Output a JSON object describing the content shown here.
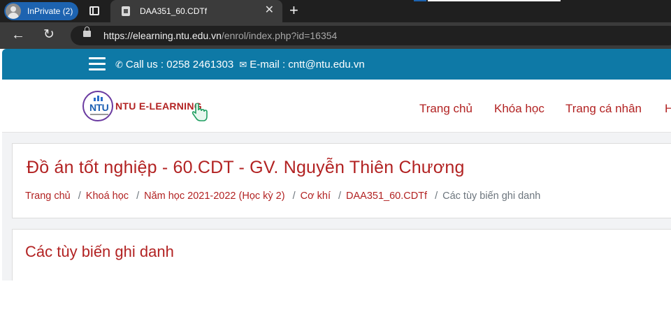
{
  "browser": {
    "profile_label": "InPrivate (2)",
    "tab_title": "DAA351_60.CDTf",
    "tab_close": "✕",
    "new_tab": "+",
    "url_host": "https://elearning.ntu.edu.vn",
    "url_path": "/enrol/index.php?id=16354"
  },
  "topbar": {
    "phone_label": "Call us : 0258 2461303",
    "email_label": "E-mail : cntt@ntu.edu.vn"
  },
  "header": {
    "logo_circle_text": "NTU",
    "logo_text": "NTU E-LEARNING",
    "nav": [
      "Trang chủ",
      "Khóa học",
      "Trang cá nhân",
      "H"
    ]
  },
  "course": {
    "title": "Đồ án tốt nghiệp - 60.CDT - GV. Nguyễn Thiên Chương",
    "breadcrumb": [
      "Trang chủ",
      "Khoá học",
      "Năm học 2021-2022 (Học kỳ 2)",
      "Cơ khí",
      "DAA351_60.CDTf"
    ],
    "breadcrumb_current": "Các tùy biến ghi danh",
    "separator": "/"
  },
  "section": {
    "title": "Các tùy biến ghi danh"
  },
  "colors": {
    "topbar_bg": "#0e79a6",
    "accent_red": "#b22222",
    "browser_dark": "#1f1f1f",
    "inprivate_blue": "#1d63b0"
  }
}
